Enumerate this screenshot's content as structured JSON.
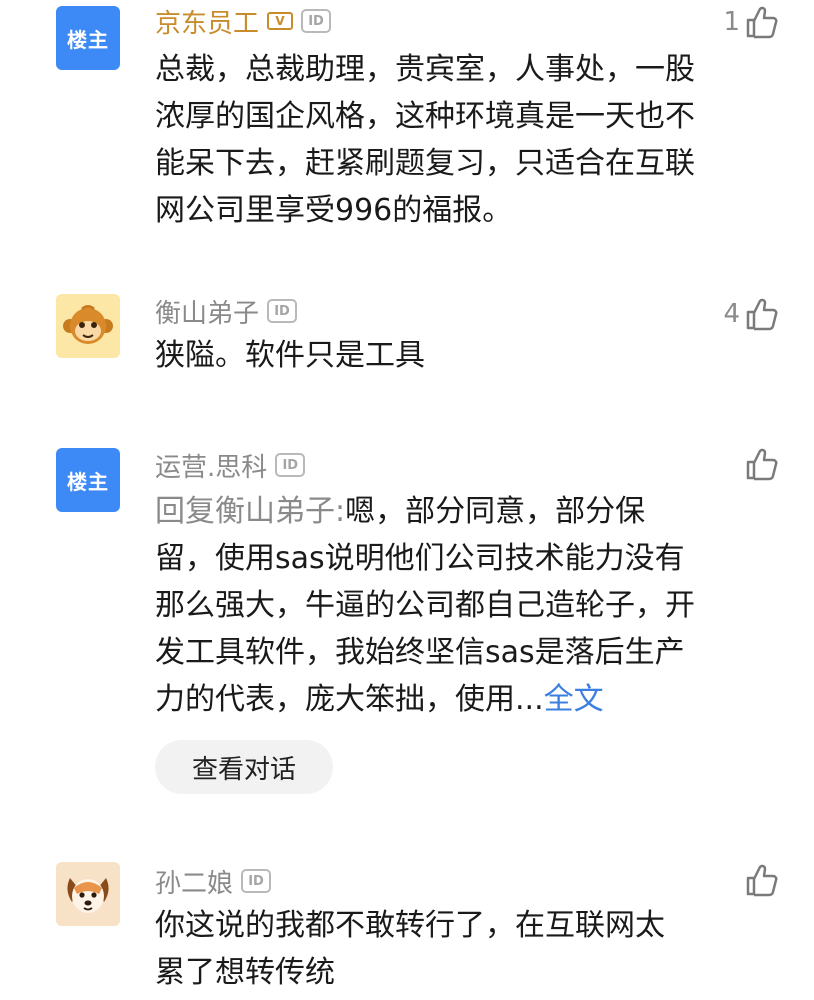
{
  "comments": [
    {
      "username": "京东员工",
      "badge": "楼主",
      "id_badge": "ID",
      "likes": "1",
      "text": "总裁，总裁助理，贵宾室，人事处，一股浓厚的国企风格，这种环境真是一天也不能呆下去，赶紧刷题复习，只适合在互联网公司里享受996的福报。"
    },
    {
      "username": "衡山弟子",
      "id_badge": "ID",
      "likes": "4",
      "text": "狭隘。软件只是工具"
    },
    {
      "username": "运营.思科",
      "badge": "楼主",
      "id_badge": "ID",
      "likes": "",
      "reply_prefix": "回复衡山弟子:",
      "text": "嗯，部分同意，部分保留，使用sas说明他们公司技术能力没有那么强大，牛逼的公司都自己造轮子，开发工具软件，我始终坚信sas是落后生产力的代表，庞大笨拙，使用...",
      "more_link": "全文",
      "view_conversation": "查看对话"
    },
    {
      "username": "孙二娘",
      "id_badge": "ID",
      "likes": "",
      "text": "你这说的我都不敢转行了，在互联网太累了想转传统"
    }
  ]
}
